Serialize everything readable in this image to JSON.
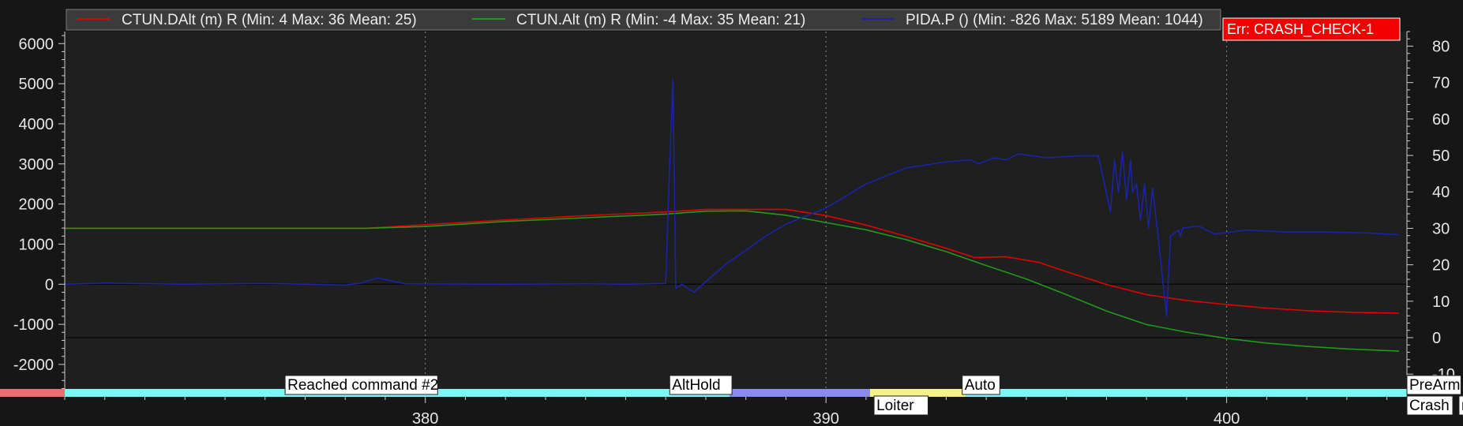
{
  "chart_data": {
    "type": "line",
    "xlim": [
      371,
      404.5
    ],
    "ylim_left": [
      -2650,
      6300
    ],
    "ylim_right": [
      -14.5,
      84
    ],
    "x_ticks": [
      380,
      390,
      400
    ],
    "y_ticks_left": [
      6000,
      5000,
      4000,
      3000,
      2000,
      1000,
      0,
      -1000,
      -2000
    ],
    "y_ticks_right": [
      80,
      70,
      60,
      50,
      40,
      30,
      20,
      10,
      0,
      -10
    ],
    "vertical_grid_at": [
      380,
      390,
      400
    ],
    "legend": {
      "position": "top"
    },
    "series": [
      {
        "name": "CTUN.DAlt (m) R (Min: 4 Max: 36 Mean: 25)",
        "color": "#e00000",
        "axis": "right",
        "x": [
          371,
          378.5,
          380,
          382,
          384,
          386,
          387,
          388,
          389,
          390,
          391,
          392,
          393,
          393.7,
          394.5,
          395.3,
          396,
          397,
          398,
          399,
          400,
          401,
          402,
          403,
          404.3
        ],
        "y": [
          30,
          30,
          31,
          32.3,
          33.5,
          34.5,
          35.2,
          35.2,
          35.2,
          33.5,
          30.9,
          27.8,
          24.5,
          22,
          22.2,
          20.7,
          18.1,
          14.6,
          11.8,
          10.2,
          9.1,
          8.1,
          7.4,
          7,
          6.7
        ]
      },
      {
        "name": "CTUN.Alt (m) R (Min: -4 Max: 35 Mean: 21)",
        "color": "#1f9a1f",
        "axis": "right",
        "x": [
          371,
          378.5,
          380,
          382,
          384,
          386,
          387,
          388,
          389,
          390,
          391,
          392,
          393,
          394,
          395,
          396,
          397,
          398,
          399,
          400,
          401,
          402,
          403,
          404.3
        ],
        "y": [
          30,
          30,
          30.5,
          31.9,
          32.9,
          33.9,
          34.7,
          34.8,
          33.6,
          31.6,
          29.6,
          26.9,
          23.6,
          19.8,
          16.1,
          11.8,
          7.3,
          3.6,
          1.5,
          -0.2,
          -1.5,
          -2.4,
          -3.1,
          -3.7
        ]
      },
      {
        "name": "PIDA.P () (Min: -826 Max: 5189 Mean: 1044)",
        "color": "#1b23a6",
        "axis": "left",
        "x": [
          371,
          372,
          374,
          376,
          378,
          378.4,
          378.8,
          379.5,
          382,
          384,
          385,
          386,
          386.08,
          386.18,
          386.25,
          386.4,
          386.7,
          387.5,
          388.5,
          389,
          390,
          391,
          392,
          393,
          393.6,
          393.8,
          394.2,
          394.5,
          394.8,
          395.5,
          396.3,
          396.8,
          397.1,
          397.2,
          397.3,
          397.4,
          397.5,
          397.6,
          397.65,
          397.75,
          397.85,
          397.95,
          398.05,
          398.15,
          398.3,
          398.5,
          398.6,
          398.8,
          398.85,
          398.9,
          399.3,
          399.7,
          400.5,
          401.5,
          402.5,
          403.5,
          404.3
        ],
        "y": [
          0,
          30,
          0,
          20,
          -20,
          30,
          160,
          10,
          0,
          10,
          0,
          20,
          2500,
          5100,
          -100,
          0,
          -200,
          500,
          1200,
          1500,
          1900,
          2500,
          2900,
          3050,
          3100,
          3000,
          3150,
          3100,
          3250,
          3150,
          3200,
          3200,
          1800,
          3100,
          2300,
          3300,
          2100,
          3100,
          2300,
          2500,
          1600,
          2500,
          1400,
          2400,
          1100,
          -800,
          1200,
          1350,
          1200,
          1400,
          1450,
          1250,
          1350,
          1300,
          1300,
          1280,
          1230
        ]
      }
    ],
    "horizontal_lines": [
      {
        "axis": "left",
        "y": 0
      },
      {
        "axis": "right",
        "y": 0
      }
    ],
    "error_badge": "Err: CRASH_CHECK-1",
    "mode_bar": [
      {
        "from": 369,
        "to": 371,
        "color": "#e87070"
      },
      {
        "from": 371,
        "to": 387.6,
        "color": "#7ff5f5"
      },
      {
        "from": 387.6,
        "to": 391.1,
        "color": "#8a8aef"
      },
      {
        "from": 391.1,
        "to": 393.5,
        "color": "#f6f08a"
      },
      {
        "from": 393.5,
        "to": 410,
        "color": "#7ff5f5"
      }
    ],
    "events": [
      {
        "label": "Reached command #2",
        "x": 376.5,
        "row": "top"
      },
      {
        "label": "AltHold",
        "x": 386.1,
        "row": "top"
      },
      {
        "label": "Loiter",
        "x": 391.2,
        "row": "bottom"
      },
      {
        "label": "Auto",
        "x": 393.4,
        "row": "top"
      },
      {
        "label": "PreArm",
        "x": 404.5,
        "row": "top"
      },
      {
        "label": "Crash",
        "x": 404.5,
        "row": "bottom"
      },
      {
        "label": "n",
        "x": 405.8,
        "row": "bottom"
      }
    ]
  }
}
